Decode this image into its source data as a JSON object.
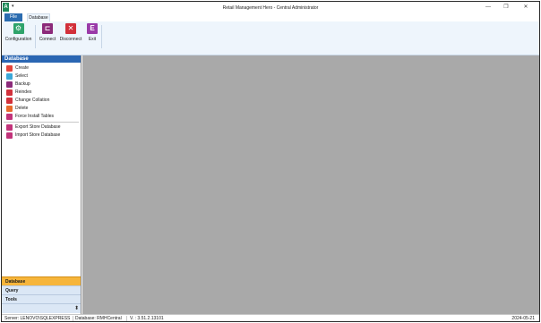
{
  "window": {
    "title": "Retail Management Hero - Central Administrator",
    "logo_letter": "A",
    "qat_glyph": "▾",
    "controls": {
      "minimize": "—",
      "maximize": "❐",
      "close": "✕"
    }
  },
  "tabs": {
    "file": "File",
    "database": "Database"
  },
  "ribbon": {
    "configuration": "Configuration",
    "connect": "Connect",
    "disconnect": "Disconnect",
    "exit": "Exit"
  },
  "sidebar": {
    "header": "Database",
    "items": [
      {
        "label": "Create",
        "icon": "create-icon",
        "color": "#e3443b"
      },
      {
        "label": "Select",
        "icon": "select-icon",
        "color": "#3aa7d8"
      },
      {
        "label": "Backup",
        "icon": "backup-icon",
        "color": "#8c2a7a"
      },
      {
        "label": "Reindex",
        "icon": "reindex-icon",
        "color": "#d2303a"
      },
      {
        "label": "Change Collation",
        "icon": "collation-icon",
        "color": "#d2303a"
      },
      {
        "label": "Delete",
        "icon": "delete-icon",
        "color": "#e86a2c"
      },
      {
        "label": "Force Install Tables",
        "icon": "install-tables-icon",
        "color": "#c2337a"
      }
    ],
    "items2": [
      {
        "label": "Export Store Database",
        "icon": "export-icon",
        "color": "#c2337a"
      },
      {
        "label": "Import Store Database",
        "icon": "import-icon",
        "color": "#c2337a"
      }
    ],
    "sections": {
      "database": "Database",
      "query": "Query",
      "tools": "Tools"
    },
    "overflow_glyph": "⬍"
  },
  "status": {
    "server": "Server: LENOVO\\SQLEXPRESS",
    "database": "Database: RMHCentral",
    "version": "V. : 3.51.2.13101",
    "date": "2024-05-21"
  },
  "colors": {
    "accent": "#2a66b3",
    "file_tab": "#2b6cb0",
    "active_section": "#f6b53b",
    "workspace": "#a9a9a9"
  }
}
